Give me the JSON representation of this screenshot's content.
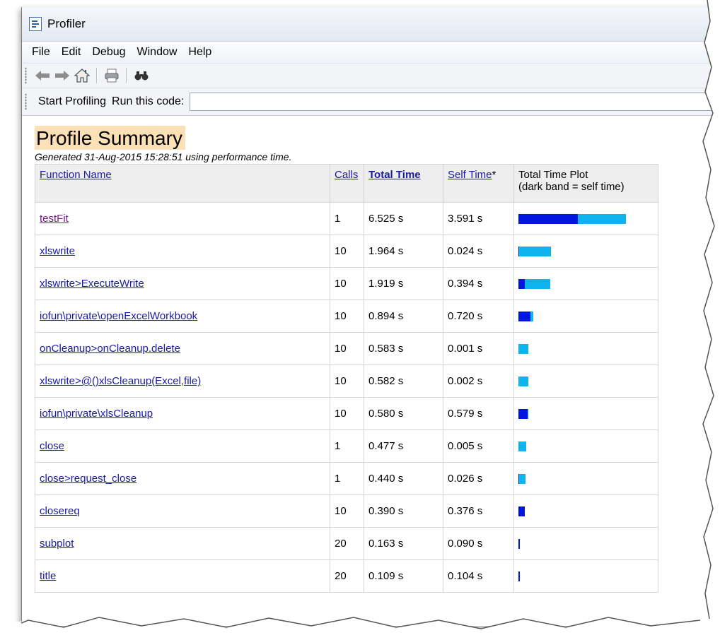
{
  "window": {
    "title": "Profiler"
  },
  "menu": [
    "File",
    "Edit",
    "Debug",
    "Window",
    "Help"
  ],
  "toolbar": {
    "icons": [
      "back-arrow-icon",
      "forward-arrow-icon",
      "home-icon",
      "print-icon",
      "find-binoculars-icon"
    ]
  },
  "runbar": {
    "start_label": "Start Profiling",
    "run_label": "Run this code:",
    "code_value": ""
  },
  "summary": {
    "title": "Profile Summary",
    "generated": "Generated 31-Aug-2015 15:28:51 using performance time."
  },
  "table": {
    "headers": {
      "name": "Function Name",
      "calls": "Calls",
      "total": "Total Time",
      "self": "Self Time",
      "self_suffix": "*",
      "plot_line1": "Total Time Plot",
      "plot_line2": "(dark band = self time)"
    },
    "rows": [
      {
        "name": "testFit",
        "calls": "1",
        "total": "6.525 s",
        "self": "3.591 s",
        "total_s": 6.525,
        "self_s": 3.591,
        "visited": true
      },
      {
        "name": "xlswrite",
        "calls": "10",
        "total": "1.964 s",
        "self": "0.024 s",
        "total_s": 1.964,
        "self_s": 0.024
      },
      {
        "name": "xlswrite>ExecuteWrite",
        "calls": "10",
        "total": "1.919 s",
        "self": "0.394 s",
        "total_s": 1.919,
        "self_s": 0.394
      },
      {
        "name": "iofun\\private\\openExcelWorkbook",
        "calls": "10",
        "total": "0.894 s",
        "self": "0.720 s",
        "total_s": 0.894,
        "self_s": 0.72
      },
      {
        "name": "onCleanup>onCleanup.delete",
        "calls": "10",
        "total": "0.583 s",
        "self": "0.001 s",
        "total_s": 0.583,
        "self_s": 0.001
      },
      {
        "name": "xlswrite>@()xlsCleanup(Excel,file)",
        "calls": "10",
        "total": "0.582 s",
        "self": "0.002 s",
        "total_s": 0.582,
        "self_s": 0.002
      },
      {
        "name": "iofun\\private\\xlsCleanup",
        "calls": "10",
        "total": "0.580 s",
        "self": "0.579 s",
        "total_s": 0.58,
        "self_s": 0.579
      },
      {
        "name": "close",
        "calls": "1",
        "total": "0.477 s",
        "self": "0.005 s",
        "total_s": 0.477,
        "self_s": 0.005
      },
      {
        "name": "close>request_close",
        "calls": "1",
        "total": "0.440 s",
        "self": "0.026 s",
        "total_s": 0.44,
        "self_s": 0.026
      },
      {
        "name": "closereq",
        "calls": "10",
        "total": "0.390 s",
        "self": "0.376 s",
        "total_s": 0.39,
        "self_s": 0.376
      },
      {
        "name": "subplot",
        "calls": "20",
        "total": "0.163 s",
        "self": "0.090 s",
        "total_s": 0.163,
        "self_s": 0.09
      },
      {
        "name": "title",
        "calls": "20",
        "total": "0.109 s",
        "self": "0.104 s",
        "total_s": 0.109,
        "self_s": 0.104
      }
    ]
  },
  "colors": {
    "self_band": "#0015e0",
    "total_band": "#0fb4ee",
    "title_highlight": "#fde1b6"
  }
}
